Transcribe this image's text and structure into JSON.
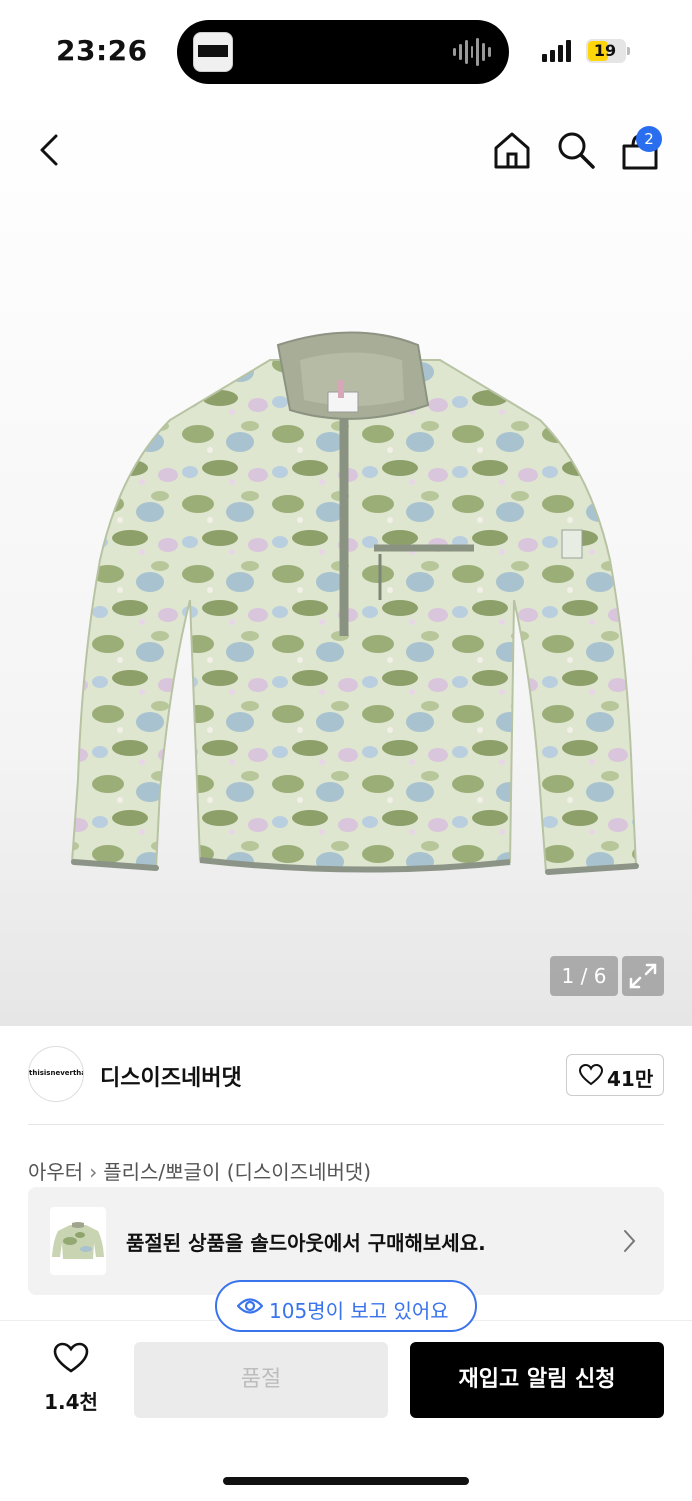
{
  "status_bar": {
    "time": "23:26",
    "battery": "19"
  },
  "gallery": {
    "counter": "1 / 6"
  },
  "header": {
    "cart_count": "2"
  },
  "brand": {
    "logo_text": "thisisneverthat",
    "name": "디스이즈네버댓",
    "likes": "41만"
  },
  "breadcrumb": {
    "category": "아우터",
    "subcategory": "플리스/뽀글이 (디스이즈네버댓)"
  },
  "soldout_banner": {
    "text": "품절된 상품을 솔드아웃에서 구매해보세요."
  },
  "viewing": {
    "text": "105명이 보고 있어요"
  },
  "bottom_bar": {
    "wishlist_count": "1.4천",
    "soldout_label": "품절",
    "restock_label": "재입고 알림 신청"
  },
  "colors": {
    "accent_blue": "#3a74ec",
    "badge_blue": "#2a6ef0",
    "button_black": "#000000",
    "disabled_gray": "#ebebeb"
  }
}
